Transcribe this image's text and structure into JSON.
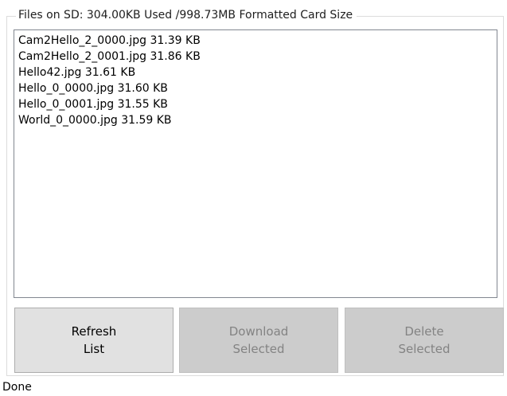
{
  "group": {
    "title": "Files on SD: 304.00KB Used /998.73MB Formatted Card Size"
  },
  "files": [
    "Cam2Hello_2_0000.jpg 31.39 KB",
    "Cam2Hello_2_0001.jpg 31.86 KB",
    "Hello42.jpg 31.61 KB",
    "Hello_0_0000.jpg 31.60 KB",
    "Hello_0_0001.jpg 31.55 KB",
    "World_0_0000.jpg 31.59 KB"
  ],
  "buttons": {
    "refresh": {
      "line1": "Refresh",
      "line2": "List"
    },
    "download": {
      "line1": "Download",
      "line2": "Selected"
    },
    "delete": {
      "line1": "Delete",
      "line2": "Selected"
    }
  },
  "status": "Done",
  "colors": {
    "button_face": "#e1e1e1",
    "button_disabled_face": "#cccccc",
    "disabled_text": "#838383",
    "list_border": "#828790"
  }
}
